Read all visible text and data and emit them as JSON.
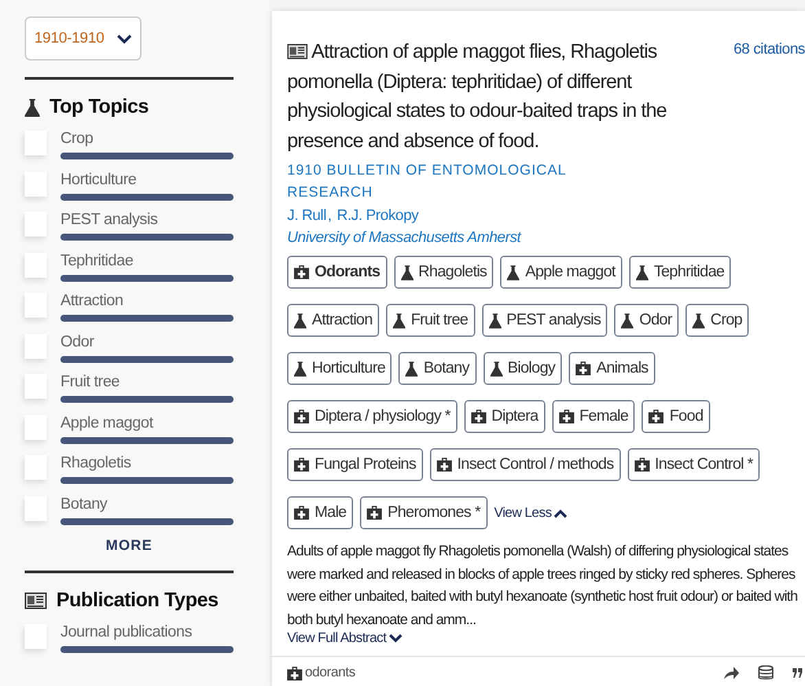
{
  "sidebar": {
    "year_filter": "1910-1910",
    "top_topics": {
      "title": "Top Topics",
      "items": [
        {
          "label": "Crop",
          "checked": false,
          "level": 1
        },
        {
          "label": "Horticulture",
          "checked": false,
          "level": 1
        },
        {
          "label": "PEST analysis",
          "checked": false,
          "level": 1
        },
        {
          "label": "Tephritidae",
          "checked": false,
          "level": 1
        },
        {
          "label": "Attraction",
          "checked": false,
          "level": 1
        },
        {
          "label": "Odor",
          "checked": false,
          "level": 1
        },
        {
          "label": "Fruit tree",
          "checked": false,
          "level": 1
        },
        {
          "label": "Apple maggot",
          "checked": false,
          "level": 1
        },
        {
          "label": "Rhagoletis",
          "checked": false,
          "level": 1
        },
        {
          "label": "Botany",
          "checked": false,
          "level": 1
        }
      ],
      "more": "MORE"
    },
    "publication_types": {
      "title": "Publication Types",
      "items": [
        {
          "label": "Journal publications",
          "checked": false,
          "level": 1
        }
      ]
    }
  },
  "article": {
    "title": "Attraction of apple maggot flies, Rhagoletis pomonella (Diptera: tephritidae) of different physiological states to odour-baited traps in the presence and absence of food.",
    "citations": "68 citations",
    "journal": "1910 BULLETIN OF ENTOMOLOGICAL RESEARCH",
    "authors": [
      "J. Rull",
      "R.J. Prokopy"
    ],
    "author_separator": ",",
    "affiliation": "University of Massachusetts Amherst",
    "tag_rows": [
      [
        {
          "label": "Odorants",
          "kind": "medical",
          "highlighted": true
        },
        {
          "label": "Rhagoletis",
          "kind": "topic",
          "highlighted": false
        },
        {
          "label": "Apple maggot",
          "kind": "topic",
          "highlighted": false
        },
        {
          "label": "Tephritidae",
          "kind": "topic",
          "highlighted": false
        }
      ],
      [
        {
          "label": "Attraction",
          "kind": "topic",
          "highlighted": false
        },
        {
          "label": "Fruit tree",
          "kind": "topic",
          "highlighted": false
        },
        {
          "label": "PEST analysis",
          "kind": "topic",
          "highlighted": false
        },
        {
          "label": "Odor",
          "kind": "topic",
          "highlighted": false
        },
        {
          "label": "Crop",
          "kind": "topic",
          "highlighted": false
        }
      ],
      [
        {
          "label": "Horticulture",
          "kind": "topic",
          "highlighted": false
        },
        {
          "label": "Botany",
          "kind": "topic",
          "highlighted": false
        },
        {
          "label": "Biology",
          "kind": "topic",
          "highlighted": false
        },
        {
          "label": "Animals",
          "kind": "medical",
          "highlighted": false
        }
      ],
      [
        {
          "label": "Diptera / physiology *",
          "kind": "medical",
          "highlighted": false
        },
        {
          "label": "Diptera",
          "kind": "medical",
          "highlighted": false
        },
        {
          "label": "Female",
          "kind": "medical",
          "highlighted": false
        },
        {
          "label": "Food",
          "kind": "medical",
          "highlighted": false
        }
      ],
      [
        {
          "label": "Fungal Proteins",
          "kind": "medical",
          "highlighted": false
        },
        {
          "label": "Insect Control / methods",
          "kind": "medical",
          "highlighted": false
        },
        {
          "label": "Insect Control *",
          "kind": "medical",
          "highlighted": false
        }
      ],
      [
        {
          "label": "Male",
          "kind": "medical",
          "highlighted": false
        },
        {
          "label": "Pheromones *",
          "kind": "medical",
          "highlighted": false
        }
      ]
    ],
    "view_less": "View Less",
    "abstract": "Adults of apple maggot fly Rhagoletis pomonella (Walsh) of differing physiological states were marked and released in blocks of apple trees ringed by sticky red spheres. Spheres were either unbaited, baited with butyl hexanoate (synthetic host fruit odour) or baited with both butyl hexanoate and amm...",
    "view_full_abstract": "View Full Abstract",
    "footer_tag": "odorants"
  }
}
